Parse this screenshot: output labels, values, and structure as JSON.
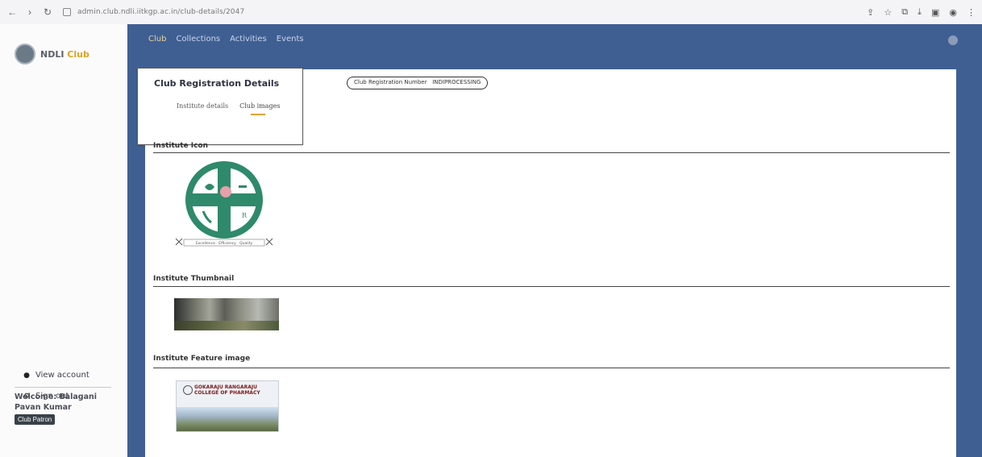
{
  "browser": {
    "url": "admin.club.ndli.iitkgp.ac.in/club-details/2047"
  },
  "sidebar": {
    "brand_prefix": "NDLI",
    "brand_accent": "Club",
    "view_account": "View account",
    "sign_out": "Sign out",
    "welcome": "Welcome: Balagani Pavan Kumar",
    "role": "Club Patron"
  },
  "topnav": {
    "tabs": [
      "Club",
      "Collections",
      "Activities",
      "Events"
    ]
  },
  "popup": {
    "title": "Club Registration Details",
    "tabs": [
      "Institute details",
      "Club images"
    ]
  },
  "registration": {
    "label": "Club Registration Number",
    "value": "INDIPROCESSING"
  },
  "sections": {
    "icon": "Institute Icon",
    "thumbnail": "Institute Thumbnail",
    "feature": "Institute Feature image"
  },
  "images": {
    "icon_motto": "Excellence · Efficiency · Quality",
    "feature_banner": "GOKARAJU RANGARAJU COLLEGE OF PHARMACY"
  },
  "colors": {
    "header_blue": "#3f5f93",
    "accent": "#e2a21a",
    "tab_underline": "#e6a037"
  }
}
